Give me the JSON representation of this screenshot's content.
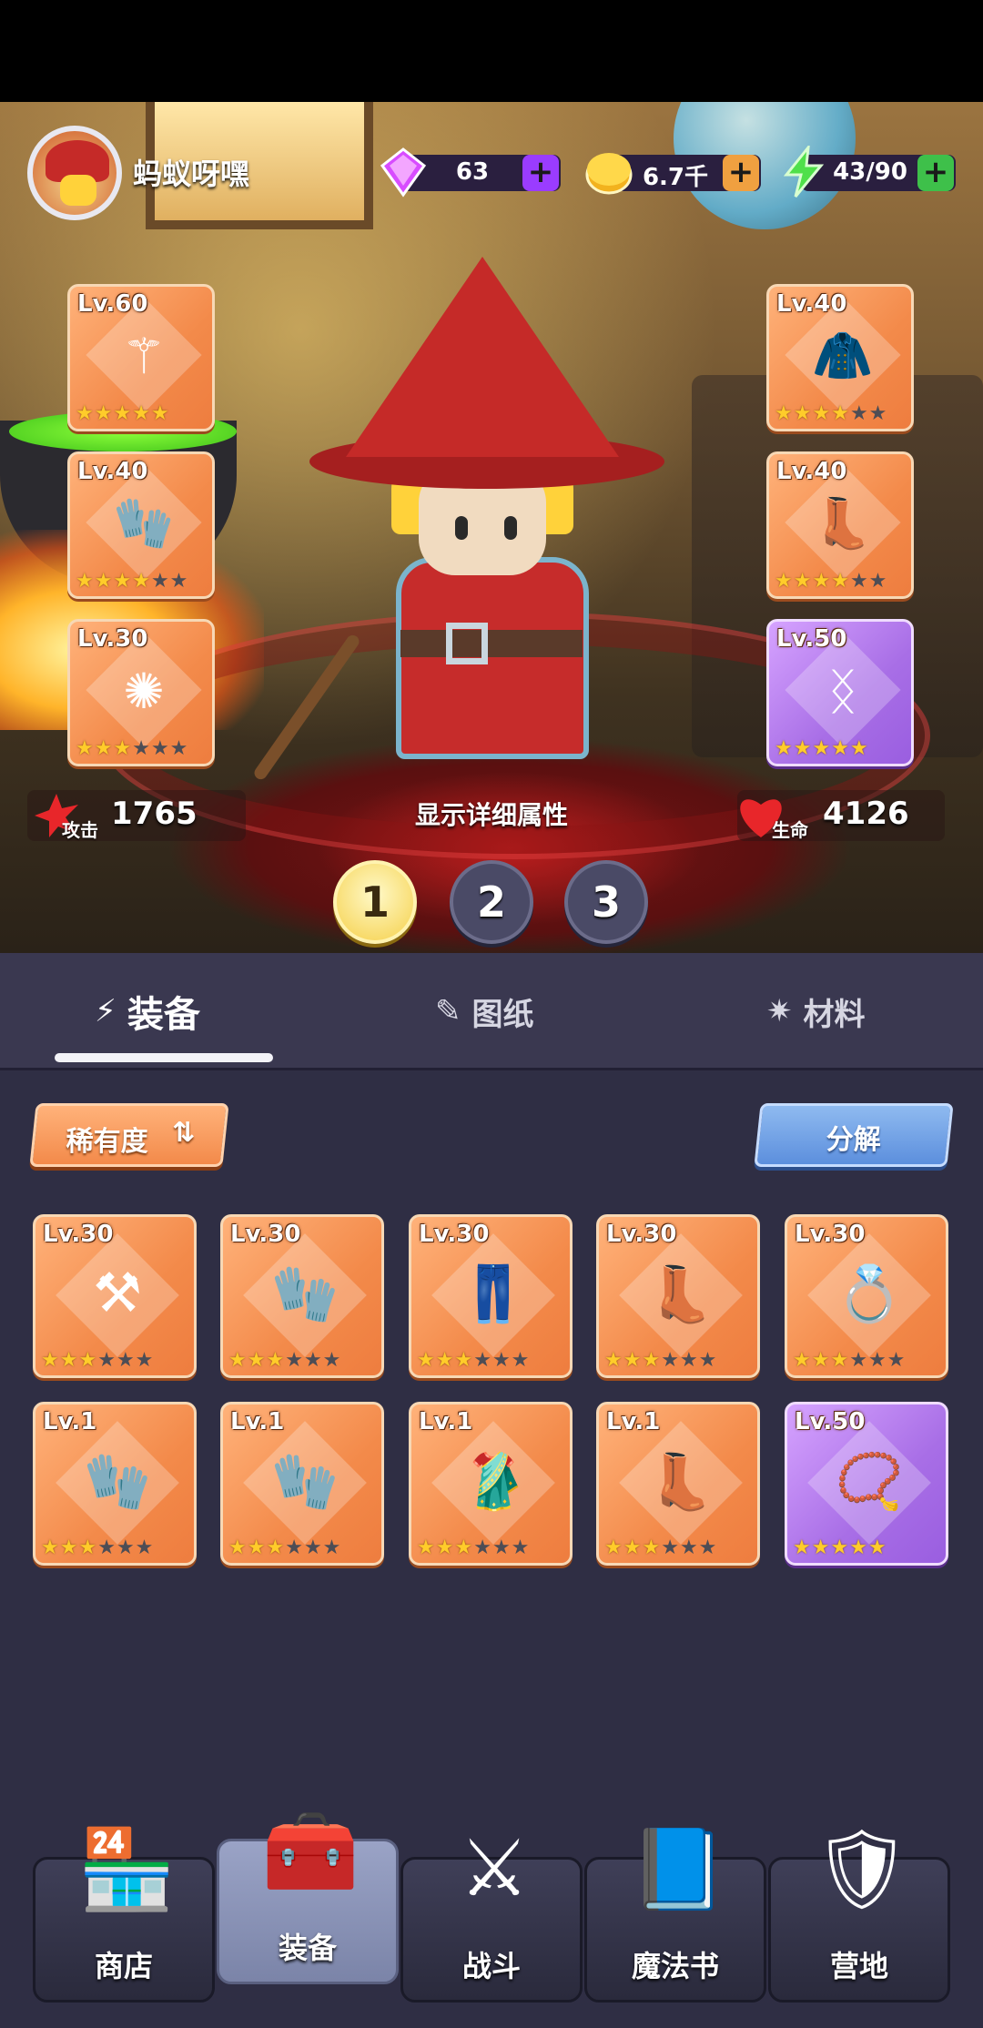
{
  "player": {
    "name": "蚂蚁呀嘿"
  },
  "resources": {
    "gems": {
      "value": "63",
      "plus": "+",
      "color": "#9a3cff"
    },
    "gold": {
      "value": "6.7千",
      "plus": "+",
      "color": "#f0a040"
    },
    "energy": {
      "value": "43/90",
      "plus": "+",
      "color": "#3ec04a"
    }
  },
  "equipped": {
    "left": [
      {
        "level": "Lv.60",
        "stars": 5,
        "max": 5,
        "icon": "staff-icon",
        "glyph": "⚚"
      },
      {
        "level": "Lv.40",
        "stars": 4,
        "max": 6,
        "icon": "gauntlets-icon",
        "glyph": "🧤"
      },
      {
        "level": "Lv.30",
        "stars": 3,
        "max": 6,
        "icon": "amulet-icon",
        "glyph": "✺"
      }
    ],
    "right": [
      {
        "level": "Lv.40",
        "stars": 4,
        "max": 6,
        "icon": "cloak-icon",
        "glyph": "🧥"
      },
      {
        "level": "Lv.40",
        "stars": 4,
        "max": 6,
        "icon": "boots-icon",
        "glyph": "👢"
      },
      {
        "level": "Lv.50",
        "stars": 5,
        "max": 5,
        "icon": "rune-stone-icon",
        "glyph": "ᛝ",
        "rarity": "purple"
      }
    ]
  },
  "stats": {
    "attack_label": "攻击",
    "attack_value": "1765",
    "detail_label": "显示详细属性",
    "hp_label": "生命",
    "hp_value": "4126"
  },
  "loadouts": [
    "1",
    "2",
    "3"
  ],
  "tabs": [
    {
      "label": "装备",
      "icon": "wand-icon",
      "glyph": "⚡"
    },
    {
      "label": "图纸",
      "icon": "blueprint-icon",
      "glyph": "✎"
    },
    {
      "label": "材料",
      "icon": "sparkle-icon",
      "glyph": "✷"
    }
  ],
  "inventory_controls": {
    "rarity_label": "稀有度",
    "sort_glyph": "⇅",
    "decompose_label": "分解"
  },
  "inventory": [
    {
      "level": "Lv.30",
      "stars": 3,
      "max": 6,
      "icon": "mace-icon",
      "glyph": "⚒"
    },
    {
      "level": "Lv.30",
      "stars": 3,
      "max": 6,
      "icon": "gloves-icon",
      "glyph": "🧤"
    },
    {
      "level": "Lv.30",
      "stars": 3,
      "max": 6,
      "icon": "leg-guards-icon",
      "glyph": "👖"
    },
    {
      "level": "Lv.30",
      "stars": 3,
      "max": 6,
      "icon": "boots-icon",
      "glyph": "👢"
    },
    {
      "level": "Lv.30",
      "stars": 3,
      "max": 6,
      "icon": "ring-icon",
      "glyph": "💍"
    },
    {
      "level": "Lv.1",
      "stars": 3,
      "max": 6,
      "icon": "gloves-icon",
      "glyph": "🧤"
    },
    {
      "level": "Lv.1",
      "stars": 3,
      "max": 6,
      "icon": "gloves-icon",
      "glyph": "🧤"
    },
    {
      "level": "Lv.1",
      "stars": 3,
      "max": 6,
      "icon": "robe-icon",
      "glyph": "🥻"
    },
    {
      "level": "Lv.1",
      "stars": 3,
      "max": 6,
      "icon": "boots-icon",
      "glyph": "👢"
    },
    {
      "level": "Lv.50",
      "stars": 5,
      "max": 5,
      "icon": "necklace-icon",
      "glyph": "📿",
      "rarity": "purple"
    }
  ],
  "nav": [
    {
      "label": "商店",
      "icon": "shop-icon",
      "glyph": "🏪"
    },
    {
      "label": "装备",
      "icon": "chest-icon",
      "glyph": "🧰",
      "active": true
    },
    {
      "label": "战斗",
      "icon": "crossed-swords-icon",
      "glyph": "⚔"
    },
    {
      "label": "魔法书",
      "icon": "spellbook-icon",
      "glyph": "📘"
    },
    {
      "label": "营地",
      "icon": "shield-icon",
      "glyph": "🛡"
    }
  ]
}
